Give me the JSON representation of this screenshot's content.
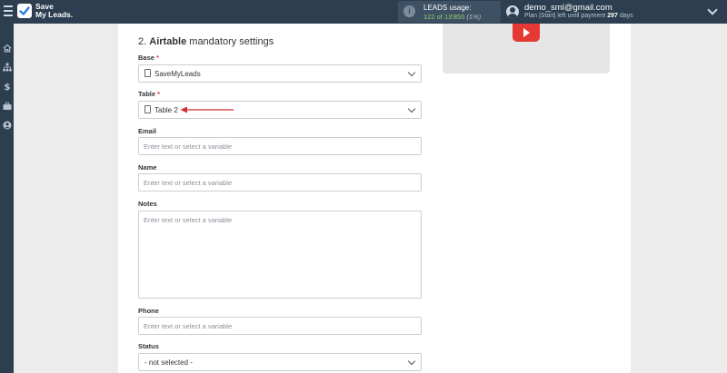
{
  "app": {
    "logo_line1": "Save",
    "logo_line2": "My Leads."
  },
  "leads": {
    "title": "LEADS usage:",
    "used": "122",
    "of_label": "of",
    "total": "13'850",
    "percent": "(1%)"
  },
  "user": {
    "email": "demo_sml@gmail.com",
    "plan_prefix": "Plan |Start| left until payment",
    "days": "297",
    "days_suffix": "days"
  },
  "sidebar": {
    "icons": [
      "home-icon",
      "sitemap-icon",
      "dollar-icon",
      "briefcase-icon",
      "user-circle-icon"
    ]
  },
  "form": {
    "section_number": "2.",
    "section_name": "Airtable",
    "section_rest": "mandatory settings",
    "base": {
      "label": "Base",
      "required_mark": "*",
      "value": "SaveMyLeads"
    },
    "table": {
      "label": "Table",
      "required_mark": "*",
      "value": "Table 2"
    },
    "email": {
      "label": "Email",
      "placeholder": "Enter text or select a variable"
    },
    "name": {
      "label": "Name",
      "placeholder": "Enter text or select a variable"
    },
    "notes": {
      "label": "Notes",
      "placeholder": "Enter text or select a variable"
    },
    "phone": {
      "label": "Phone",
      "placeholder": "Enter text or select a variable"
    },
    "status": {
      "label": "Status",
      "value": "- not selected -"
    }
  },
  "colors": {
    "topbar": "#2c3e50",
    "required": "#e53935",
    "leads_count": "#9ccc65",
    "youtube": "#e53935"
  }
}
